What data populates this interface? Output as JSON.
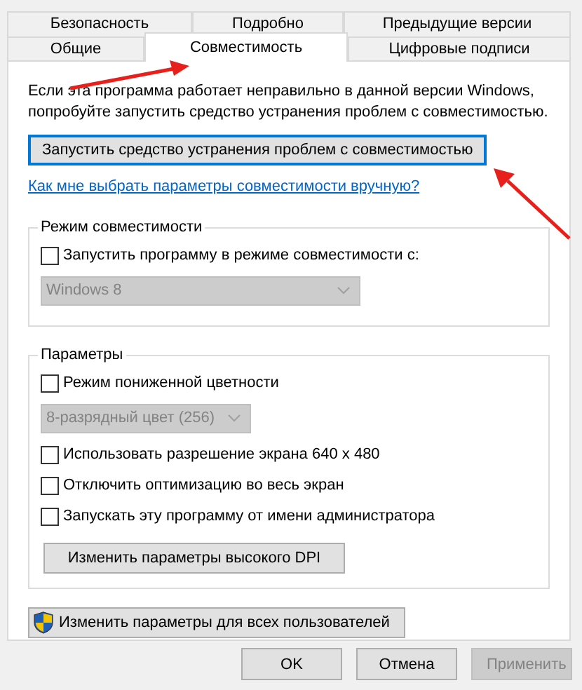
{
  "tab_rows": [
    [
      {
        "label": "Безопасность",
        "selected": false
      },
      {
        "label": "Подробно",
        "selected": false
      },
      {
        "label": "Предыдущие версии",
        "selected": false
      }
    ],
    [
      {
        "label": "Общие",
        "selected": false
      },
      {
        "label": "Совместимость",
        "selected": true
      },
      {
        "label": "Цифровые подписи",
        "selected": false
      }
    ]
  ],
  "description": "Если эта программа работает неправильно в данной версии Windows, попробуйте запустить средство устранения проблем с совместимостью.",
  "troubleshoot_button": {
    "label": "Запустить средство устранения проблем с совместимостью",
    "focused": true
  },
  "help_link": "Как мне выбрать параметры совместимости вручную?",
  "compat_group": {
    "title": "Режим совместимости",
    "items": [
      {
        "kind": "checkbox",
        "label": "Запустить программу в режиме совместимости с:",
        "checked": false
      },
      {
        "kind": "select",
        "value": "Windows 8",
        "disabled": true
      }
    ]
  },
  "settings_group": {
    "title": "Параметры",
    "items": [
      {
        "kind": "checkbox",
        "label": "Режим пониженной цветности",
        "checked": false
      },
      {
        "kind": "select",
        "value": "8-разрядный цвет (256)",
        "disabled": true
      },
      {
        "kind": "checkbox",
        "label": "Использовать разрешение экрана 640 x 480",
        "checked": false
      },
      {
        "kind": "checkbox",
        "label": "Отключить оптимизацию во весь экран",
        "checked": false
      },
      {
        "kind": "checkbox",
        "label": "Запускать эту программу от имени администратора",
        "checked": false
      },
      {
        "kind": "button",
        "label": "Изменить параметры высокого DPI"
      }
    ]
  },
  "all_users_button": {
    "label": "Изменить параметры для всех пользователей"
  },
  "footer_buttons": [
    {
      "label": "OK",
      "disabled": false
    },
    {
      "label": "Отмена",
      "disabled": false
    },
    {
      "label": "Применить",
      "disabled": true
    }
  ]
}
